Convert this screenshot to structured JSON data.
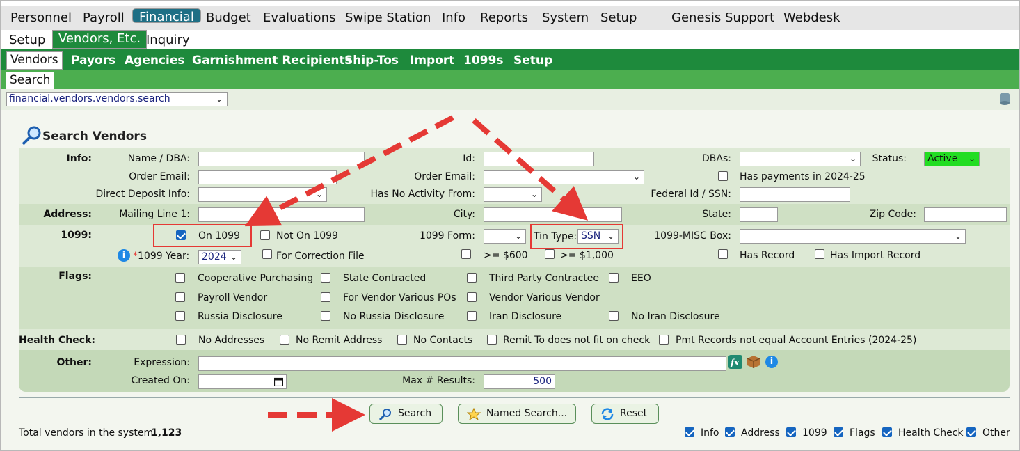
{
  "nav": {
    "top": [
      "Personnel",
      "Payroll",
      "Financial",
      "Budget",
      "Evaluations",
      "Swipe Station",
      "Info",
      "Reports",
      "System",
      "Setup",
      "Genesis Support",
      "Webdesk"
    ],
    "second": [
      "Setup",
      "Vendors, Etc.",
      "Inquiry"
    ],
    "third": [
      "Vendors",
      "Payors",
      "Agencies",
      "Garnishment Recipients",
      "Ship-Tos",
      "Import",
      "1099s",
      "Setup"
    ],
    "fourth": "Search"
  },
  "path_select": "financial.vendors.vendors.search",
  "page_title": "Search Vendors",
  "sections": {
    "info": "Info:",
    "address": "Address:",
    "n1099": "1099:",
    "flags": "Flags:",
    "health": "Health Check:",
    "other": "Other:"
  },
  "info": {
    "name_dba": "Name / DBA:",
    "id": "Id:",
    "dbas": "DBAs:",
    "status": "Status:",
    "status_value": "Active",
    "order_email": "Order Email:",
    "order_email2": "Order Email:",
    "has_payments": "Has payments in 2024-25",
    "direct_deposit": "Direct Deposit Info:",
    "no_activity": "Has No Activity From:",
    "federal_id": "Federal Id / SSN:"
  },
  "address": {
    "mailing1": "Mailing Line 1:",
    "city": "City:",
    "state": "State:",
    "zip": "Zip Code:"
  },
  "t1099": {
    "on1099": "On 1099",
    "not_on1099": "Not On 1099",
    "form": "1099 Form:",
    "tin_type": "Tin Type:",
    "tin_value": "SSN",
    "misc_box": "1099-MISC Box:",
    "year_label": "1099 Year:",
    "year_required": "*",
    "year_value": "2024",
    "correction": "For Correction File",
    "ge600": ">= $600",
    "ge1000": ">= $1,000",
    "has_record": "Has Record",
    "has_import": "Has Import Record"
  },
  "flags": [
    [
      "Cooperative Purchasing",
      "State Contracted",
      "Third Party Contractee",
      "EEO"
    ],
    [
      "Payroll Vendor",
      "For Vendor Various POs",
      "Vendor Various Vendor",
      ""
    ],
    [
      "Russia Disclosure",
      "No Russia Disclosure",
      "Iran Disclosure",
      "No Iran Disclosure"
    ]
  ],
  "health": [
    "No Addresses",
    "No Remit Address",
    "No Contacts",
    "Remit To does not fit on check",
    "Pmt Records not equal Account Entries (2024-25)"
  ],
  "other": {
    "expression": "Expression:",
    "created_on": "Created On:",
    "max_results": "Max # Results:",
    "max_value": "500"
  },
  "buttons": {
    "search": "Search",
    "named": "Named Search...",
    "reset": "Reset"
  },
  "footer": {
    "total_label": "Total vendors in the system:",
    "total_value": "1,123"
  },
  "toggles": [
    "Info",
    "Address",
    "1099",
    "Flags",
    "Health Check",
    "Other"
  ],
  "colors": {
    "accent_nav": "#1e6f85",
    "green": "#1e8a3c",
    "active_status": "#22dd22",
    "annotation": "#e53935"
  }
}
